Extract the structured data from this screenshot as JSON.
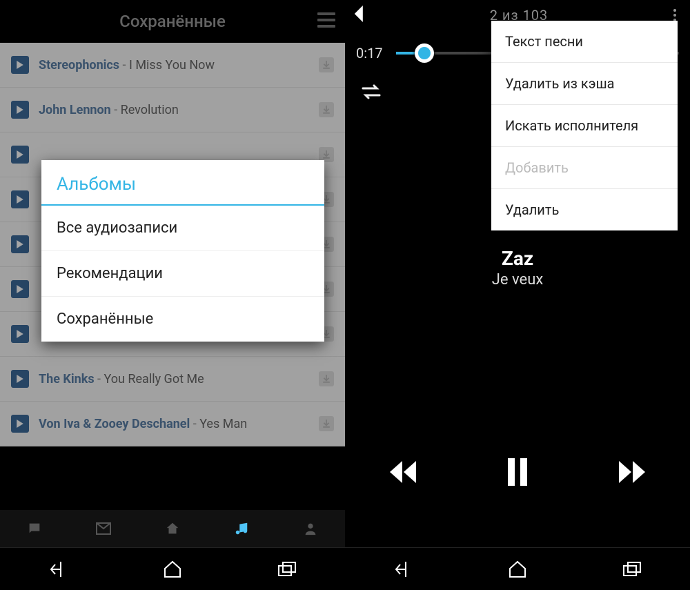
{
  "left": {
    "header": {
      "title": "Сохранённые"
    },
    "tracks": [
      {
        "artist": "Stereophonics",
        "sep": " - ",
        "title": "I Miss You Now"
      },
      {
        "artist": "John Lennon",
        "sep": " - ",
        "title": "Revolution"
      },
      {
        "artist": "",
        "sep": "",
        "title": ""
      },
      {
        "artist": "",
        "sep": "",
        "title": ""
      },
      {
        "artist": "",
        "sep": "",
        "title": ""
      },
      {
        "artist": "",
        "sep": "",
        "title": ""
      },
      {
        "artist": "",
        "sep": "",
        "title": ""
      },
      {
        "artist": "The Kinks",
        "sep": " - ",
        "title": "You Really Got Me"
      },
      {
        "artist": "Von Iva &  Zooey Deschanel",
        "sep": " - ",
        "title": "Yes Man"
      }
    ],
    "dialog": {
      "title": "Альбомы",
      "items": [
        "Все аудиозаписи",
        "Рекомендации",
        "Сохранённые"
      ]
    }
  },
  "right": {
    "counter": "2 из 103",
    "time": "0:17",
    "song": {
      "artist": "Zaz",
      "title": "Je veux"
    },
    "menu": {
      "items": [
        {
          "label": "Текст песни",
          "disabled": false
        },
        {
          "label": "Удалить из кэша",
          "disabled": false
        },
        {
          "label": "Искать исполнителя",
          "disabled": false
        },
        {
          "label": "Добавить",
          "disabled": true
        },
        {
          "label": "Удалить",
          "disabled": false
        }
      ]
    }
  }
}
